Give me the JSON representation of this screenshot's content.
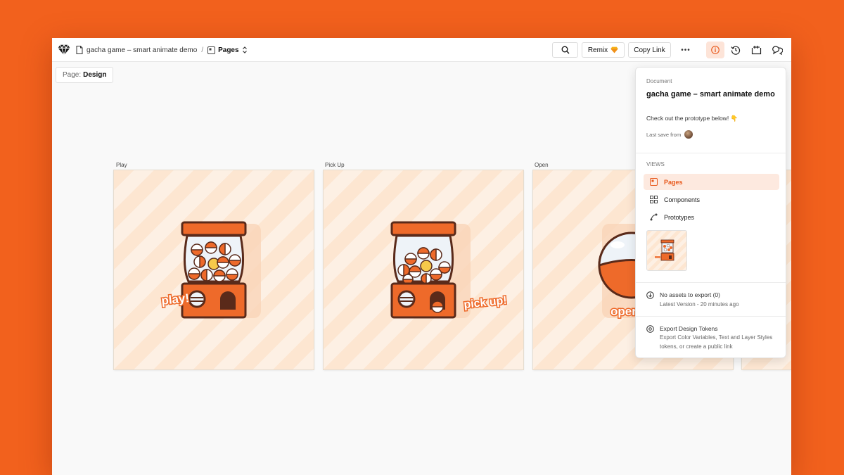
{
  "toolbar": {
    "doc_title": "gacha game – smart animate demo",
    "separator": "/",
    "pages_label": "Pages",
    "remix_label": "Remix",
    "copy_link_label": "Copy Link",
    "more_label": "•••"
  },
  "canvas": {
    "page_chip_prefix": "Page:",
    "page_chip_name": "Design",
    "artboards": [
      {
        "label": "Play",
        "caption": "play!"
      },
      {
        "label": "Pick Up",
        "caption": "pick up!"
      },
      {
        "label": "Open",
        "caption": "open"
      }
    ]
  },
  "panel": {
    "section_document": "Document",
    "title": "gacha game – smart animate demo",
    "description": "Check out the prototype below! 👇",
    "last_save": "Last save from",
    "section_views": "VIEWS",
    "views": [
      {
        "label": "Pages",
        "icon": "pages-icon",
        "active": true
      },
      {
        "label": "Components",
        "icon": "components-icon",
        "active": false
      },
      {
        "label": "Prototypes",
        "icon": "prototypes-icon",
        "active": false
      }
    ],
    "assets_title": "No assets to export (0)",
    "assets_sub": "Latest Version - 20 minutes ago",
    "tokens_title": "Export Design Tokens",
    "tokens_sub": "Export Color Variables, Text and Layer Styles tokens, or create a public link"
  },
  "colors": {
    "background": "#f2611d",
    "accent": "#e8581b",
    "machine_orange": "#ee6a2a",
    "machine_outline": "#5a2a1a"
  }
}
